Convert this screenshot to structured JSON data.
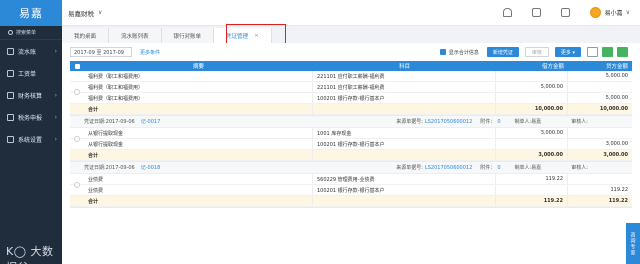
{
  "app": {
    "logo": "易嘉"
  },
  "sidebar": {
    "search_label": "搜索菜单",
    "items": [
      {
        "label": "流水账"
      },
      {
        "label": "工资单"
      },
      {
        "label": "财务核算"
      },
      {
        "label": "税务申报"
      },
      {
        "label": "系统设置"
      }
    ],
    "watermark": "大数据谷"
  },
  "topbar": {
    "company": "易嘉财税",
    "user_name": "易小嘉"
  },
  "tabs": [
    {
      "label": "我的桌面"
    },
    {
      "label": "流水账列表"
    },
    {
      "label": "银行对账单"
    },
    {
      "label": "凭证管理",
      "close": "×"
    }
  ],
  "filter": {
    "date_range": "2017-09 至 2017-09",
    "more_conditions": "更多条件",
    "show_total_label": "显示合计信息",
    "new_voucher": "新增凭证",
    "audit": "审核",
    "more": "更多 ▾"
  },
  "grid": {
    "headers": {
      "summary": "摘要",
      "subject": "科目",
      "debit": "借方金额",
      "credit": "贷方金额"
    }
  },
  "vouchers": [
    {
      "rows": [
        {
          "summary": "福利费（职工和福费用）",
          "subject": "221101 应付职工薪酬-福利费",
          "debit": "",
          "credit": "5,000.00"
        },
        {
          "summary": "福利费（职工和福费用）",
          "subject": "221101 应付职工薪酬-福利费",
          "debit": "5,000.00",
          "credit": ""
        },
        {
          "summary": "福利费（职工和福费用）",
          "subject": "100201 银行存款-银行基本户",
          "debit": "",
          "credit": "5,000.00"
        },
        {
          "summary": "合计",
          "subject": "",
          "debit": "10,000.00",
          "credit": "10,000.00",
          "total": true
        }
      ]
    },
    {
      "header": {
        "date_label": "凭证日期:2017-09-06",
        "voucher_no": "记-0017",
        "source_label": "来源单据号:",
        "source_no": "LS2017050600012",
        "attach_label": "附件：",
        "attach_no": "0",
        "maker": "制单人:易嘉",
        "auditor": "审核人:"
      },
      "rows": [
        {
          "summary": "从银行提取现金",
          "subject": "1001 库存现金",
          "debit": "3,000.00",
          "credit": ""
        },
        {
          "summary": "从银行提取现金",
          "subject": "100201 银行存款-银行基本户",
          "debit": "",
          "credit": "3,000.00"
        },
        {
          "summary": "合计",
          "subject": "",
          "debit": "3,000.00",
          "credit": "3,000.00",
          "total": true
        }
      ]
    },
    {
      "header": {
        "date_label": "凭证日期:2017-09-06",
        "voucher_no": "记-0018",
        "source_label": "来源单据号:",
        "source_no": "LS2017050600012",
        "attach_label": "附件：",
        "attach_no": "0",
        "maker": "制单人:易嘉",
        "auditor": "审核人:"
      },
      "rows": [
        {
          "summary": "业债费",
          "subject": "560229 管理费用-业债费",
          "debit": "119.22",
          "credit": ""
        },
        {
          "summary": "业债费",
          "subject": "100201 银行存款-银行基本户",
          "debit": "",
          "credit": "119.22"
        },
        {
          "summary": "合计",
          "subject": "",
          "debit": "119.22",
          "credit": "119.22",
          "total": true
        }
      ]
    }
  ],
  "float_button": "咨询专家",
  "colors": {
    "primary": "#2c89d8",
    "sidebar": "#1f2d3d",
    "highlight": "#e02020"
  }
}
